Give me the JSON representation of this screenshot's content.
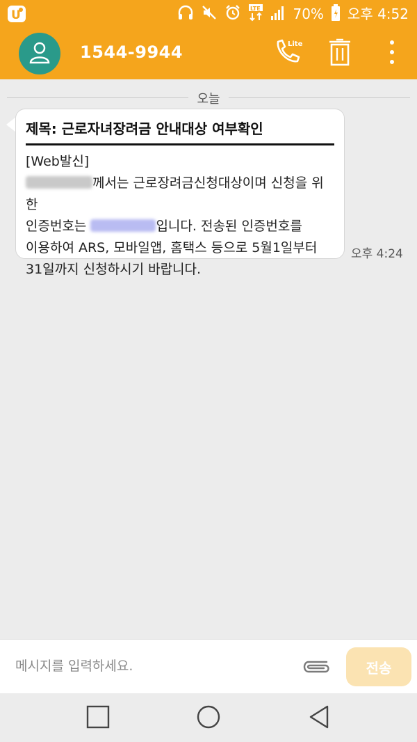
{
  "status_bar": {
    "battery_text": "70%",
    "time": "오후 4:52",
    "icons": [
      "carrier-logo-icon",
      "headphones-icon",
      "mute-icon",
      "alarm-icon",
      "lte-icon",
      "signal-icon",
      "battery-icon"
    ],
    "color": "#f5a51c"
  },
  "header": {
    "contact_name": "1544-9944",
    "avatar_icon": "person-icon",
    "actions": [
      "call-icon",
      "delete-icon",
      "more-icon"
    ],
    "call_badge_text": "Lite"
  },
  "conversation": {
    "date_separator": "오늘",
    "messages": [
      {
        "subject": "제목: 근로자녀장려금 안내대상 여부확인",
        "line1": "[Web발신]",
        "line2": "께서는 근로장려금신청대상이며 신청을 위한",
        "line3_prefix": "인증번호는 ",
        "line3_suffix": "입니다. 전송된 인증번호를",
        "line4": "이용하여 ARS, 모바일앱, 홈택스 등으로 5월1일부터",
        "line5": "31일까지 신청하시기 바랍니다.",
        "time": "오후 4:24"
      }
    ]
  },
  "compose": {
    "placeholder": "메시지를 입력하세요.",
    "send_label": "전송",
    "attach_icon": "paperclip-icon"
  },
  "navigation": {
    "buttons": [
      "recents-icon",
      "home-icon",
      "back-icon"
    ]
  }
}
